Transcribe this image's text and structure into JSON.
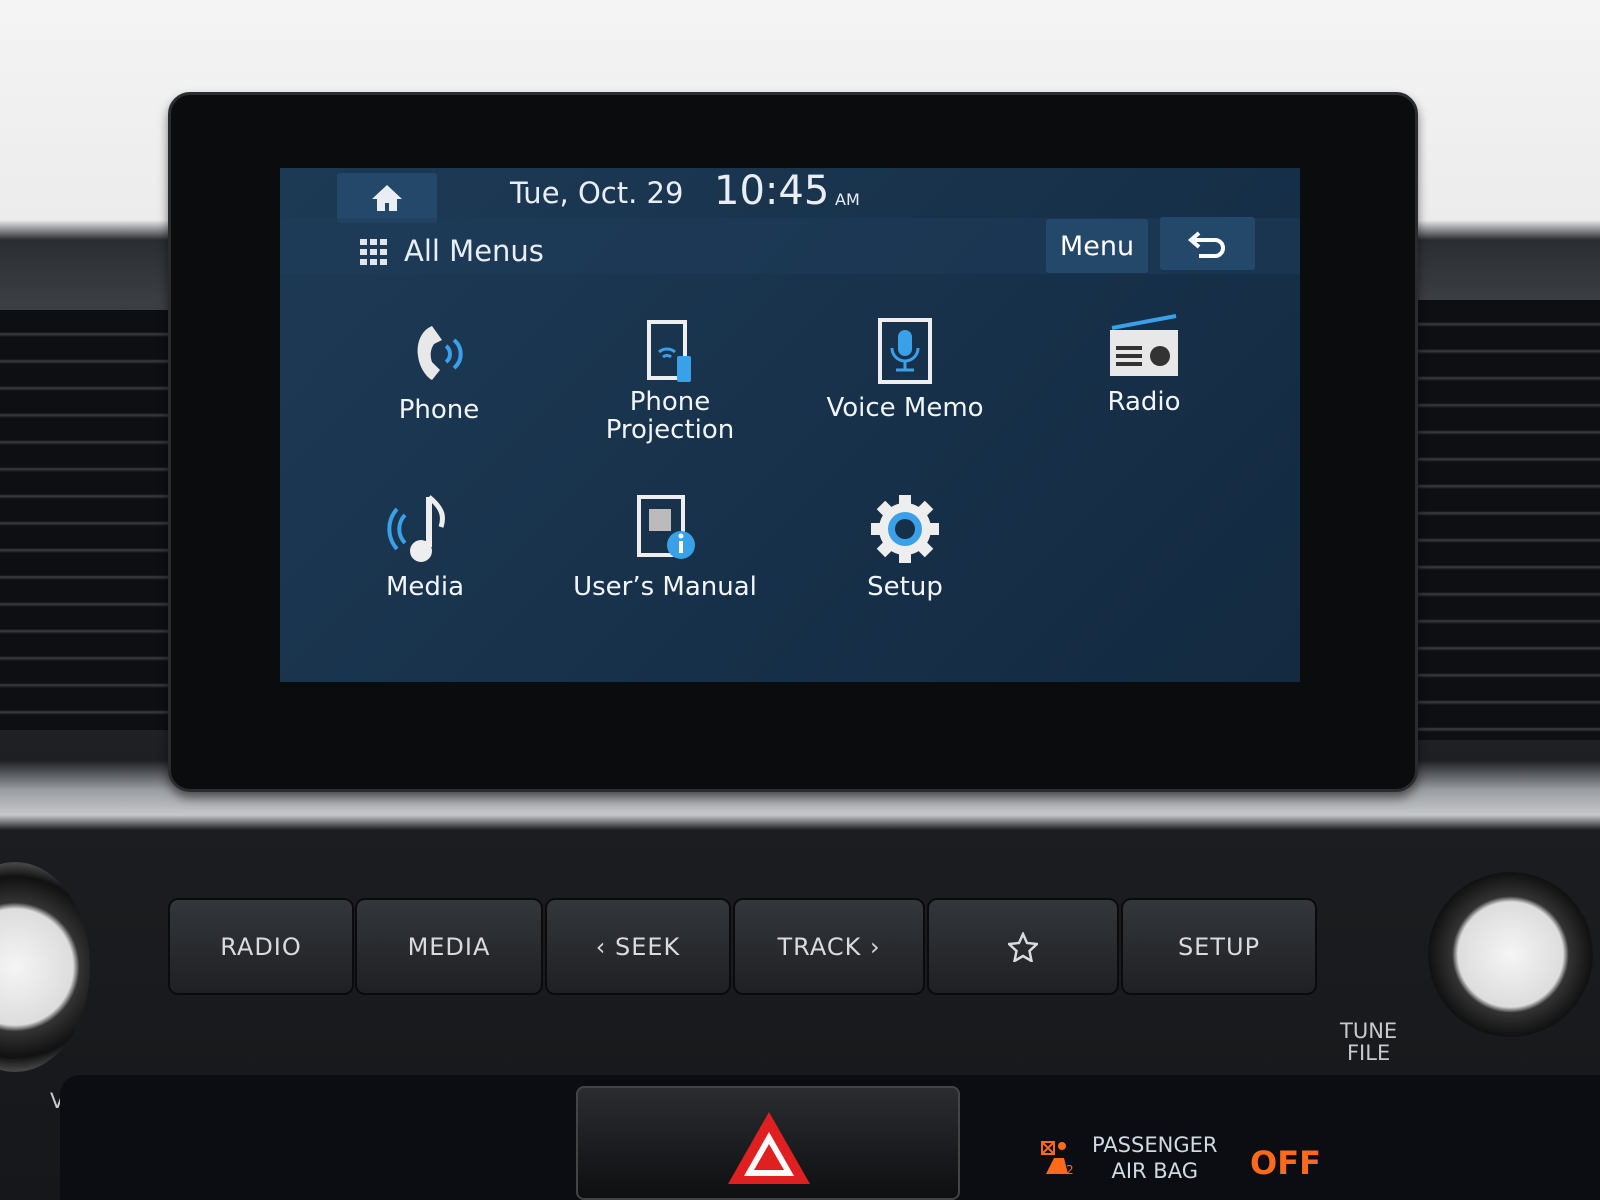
{
  "status_bar": {
    "date": "Tue, Oct. 29",
    "time": "10:45",
    "ampm": "AM",
    "home_icon": "home-icon"
  },
  "header": {
    "title": "All Menus",
    "grid_icon": "grid-icon",
    "menu_label": "Menu",
    "back_icon": "back-arrow-icon"
  },
  "apps": [
    {
      "label": "Phone",
      "icon": "phone-icon"
    },
    {
      "label": "Phone\nProjection",
      "line1": "Phone",
      "line2": "Projection",
      "icon": "phone-projection-icon"
    },
    {
      "label": "Voice Memo",
      "icon": "microphone-icon"
    },
    {
      "label": "Radio",
      "icon": "radio-icon"
    },
    {
      "label": "Media",
      "icon": "music-note-icon"
    },
    {
      "label": "User’s Manual",
      "icon": "manual-info-icon"
    },
    {
      "label": "Setup",
      "icon": "gear-icon"
    }
  ],
  "hardware_buttons": {
    "radio": "RADIO",
    "media": "MEDIA",
    "seek": "‹ SEEK",
    "track": "TRACK ›",
    "favorite_icon": "star-icon",
    "setup": "SETUP"
  },
  "knobs": {
    "vol": "VOL",
    "tune_1": "TUNE",
    "tune_2": "FILE"
  },
  "airbag": {
    "line1": "PASSENGER",
    "line2": "AIR BAG",
    "status": "OFF",
    "status_color": "#ff6a1a"
  },
  "colors": {
    "accent": "#3aa0e8",
    "screen_bg": "#173049"
  }
}
